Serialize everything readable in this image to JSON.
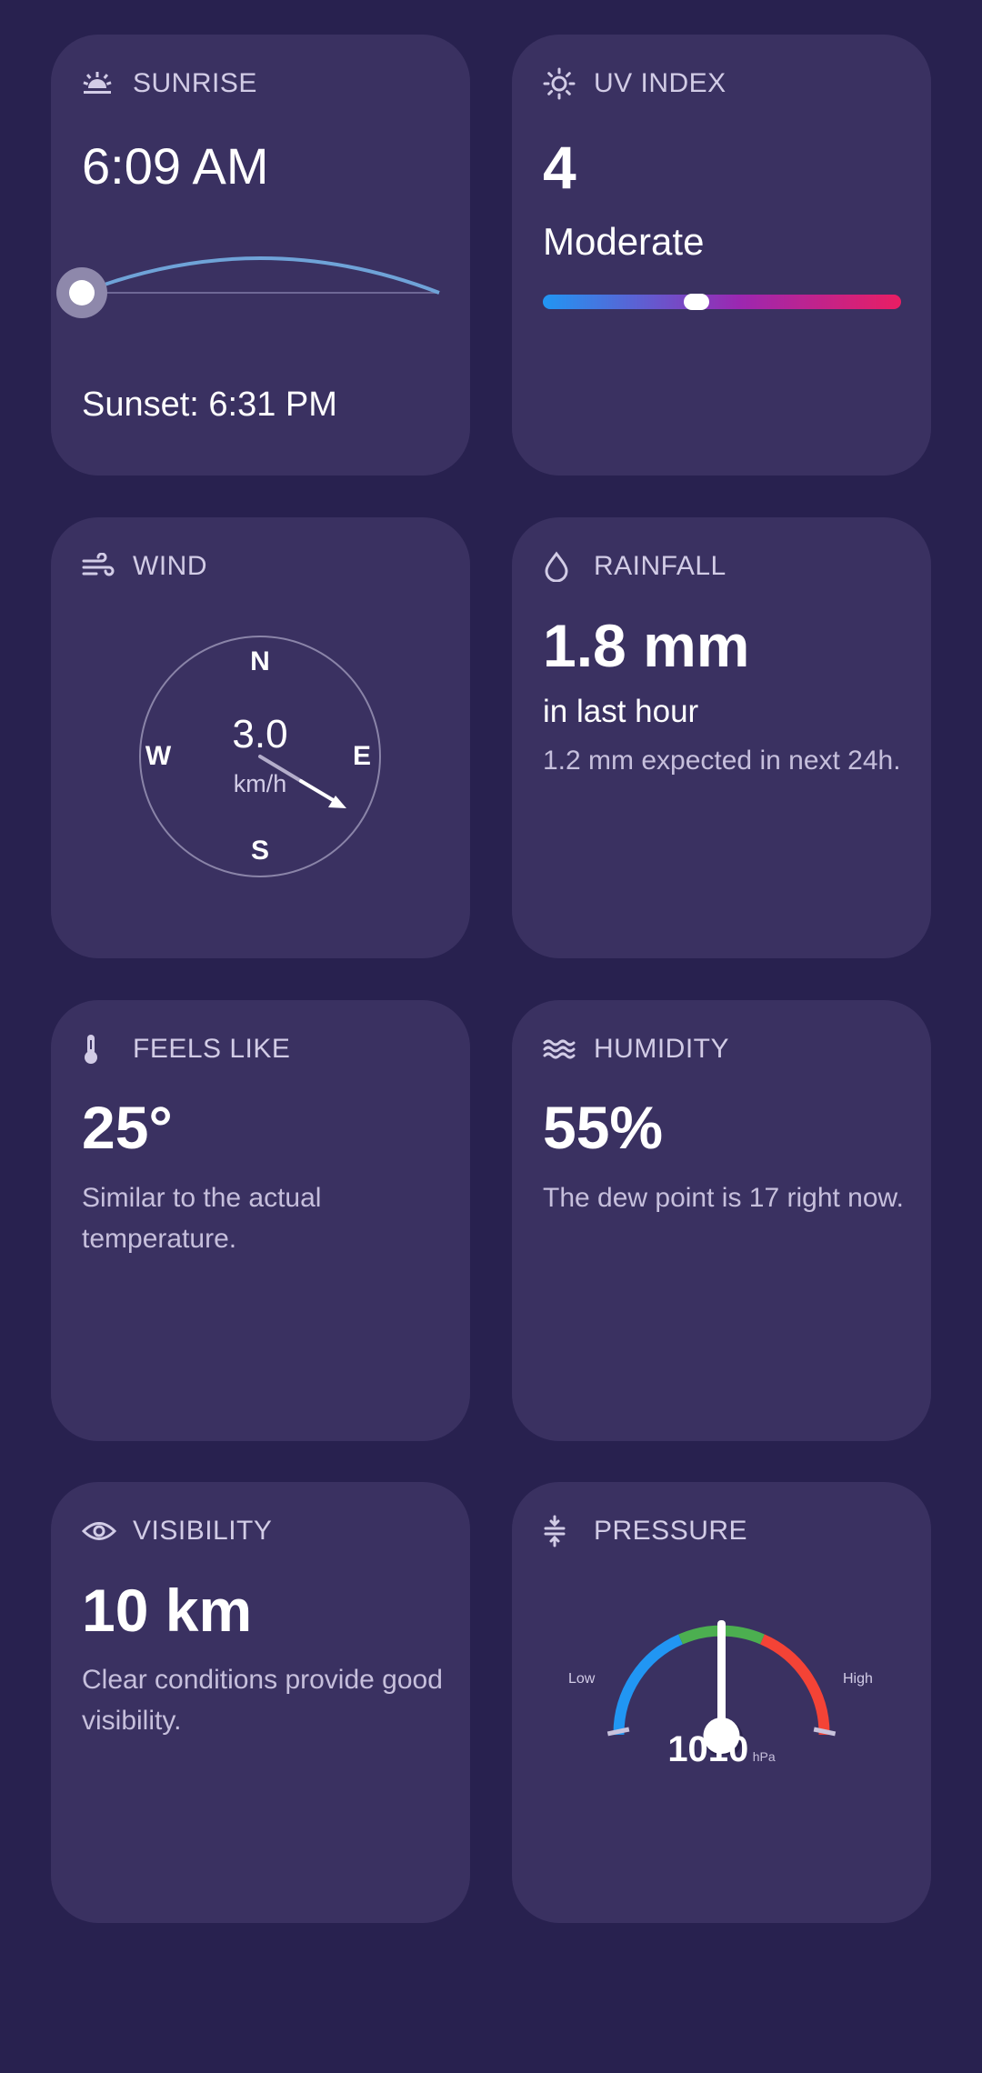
{
  "sunrise": {
    "title": "SUNRISE",
    "icon": "sunrise-icon",
    "time": "6:09 AM",
    "sunset_text": "Sunset: 6:31 PM"
  },
  "uv": {
    "title": "UV INDEX",
    "icon": "sun-icon",
    "value": "4",
    "level": "Moderate",
    "fraction": 0.43
  },
  "wind": {
    "title": "WIND",
    "icon": "wind-icon",
    "speed": "3.0",
    "unit": "km/h",
    "north": "N",
    "south": "S",
    "east": "E",
    "west": "W"
  },
  "rainfall": {
    "title": "RAINFALL",
    "icon": "droplet-icon",
    "value": "1.8 mm",
    "period": "in last hour",
    "forecast": "1.2 mm expected in next 24h."
  },
  "feels_like": {
    "title": "FEELS LIKE",
    "icon": "thermometer-icon",
    "value": "25°",
    "description": "Similar to the actual temperature."
  },
  "humidity": {
    "title": "HUMIDITY",
    "icon": "waves-icon",
    "value": "55%",
    "description": "The dew point is 17 right now."
  },
  "visibility": {
    "title": "VISIBILITY",
    "icon": "eye-icon",
    "value": "10 km",
    "description": "Clear conditions provide good visibility."
  },
  "pressure": {
    "title": "PRESSURE",
    "icon": "pressure-icon",
    "value": "1010",
    "unit": "hPa",
    "low_label": "Low",
    "high_label": "High"
  },
  "colors": {
    "background": "#28214f",
    "card": "#3a3161",
    "uv_start": "#2196f3",
    "uv_mid": "#9c27b0",
    "uv_end": "#e91e63",
    "gauge_blue": "#2196f3",
    "gauge_green": "#4caf50",
    "gauge_red": "#f44336"
  }
}
